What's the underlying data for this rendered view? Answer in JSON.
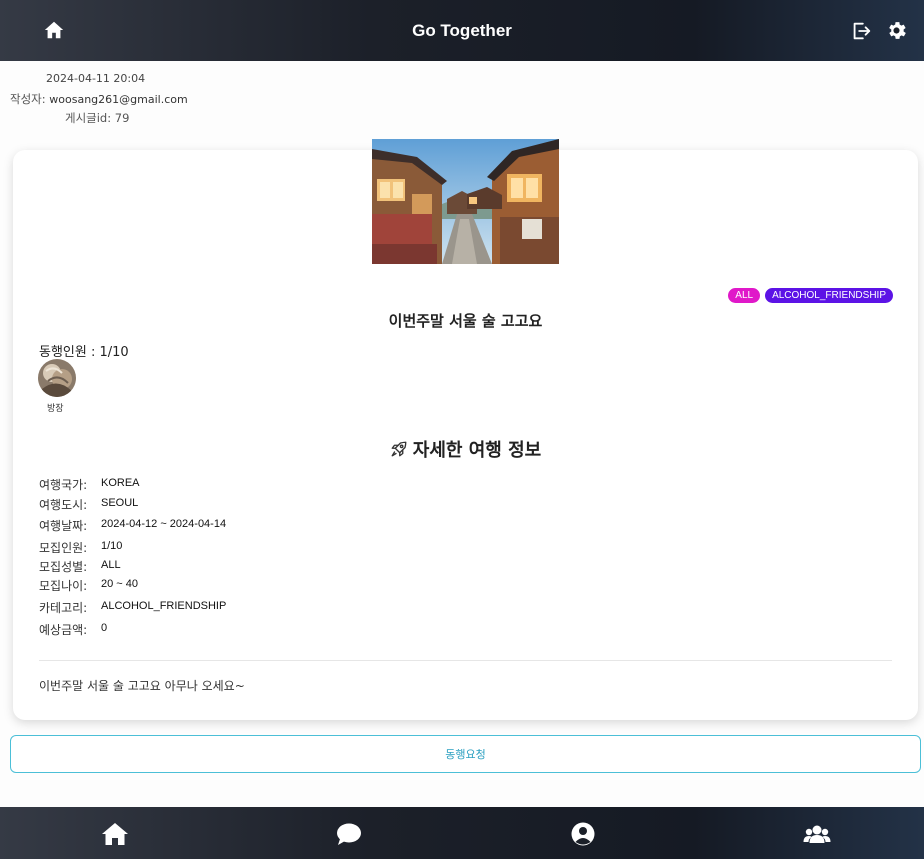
{
  "header": {
    "title": "Go Together"
  },
  "post_meta": {
    "date": "2024-04-11 20:04",
    "author_label": "작성자:",
    "author_value": "woosang261@gmail.com",
    "post_id_label": "게시글id:",
    "post_id_value": "79"
  },
  "post": {
    "tags": [
      "ALL",
      "ALCOHOL_FRIENDSHIP"
    ],
    "title": "이번주말 서울 술 고고요",
    "members_label": "동행인원 : 1/10",
    "leader_label": "방장",
    "details_title": "자세한 여행 정보",
    "details": [
      {
        "label": "여행국가:",
        "value": "KOREA"
      },
      {
        "label": "여행도시:",
        "value": "SEOUL"
      },
      {
        "label": "여행날짜:",
        "value": "2024-04-12 ~ 2024-04-14"
      },
      {
        "label": "모집인원:",
        "value": "1/10"
      },
      {
        "label": "모집성별:",
        "value": "ALL"
      },
      {
        "label": "모집나이:",
        "value": "20 ~ 40"
      },
      {
        "label": "카테고리:",
        "value": "ALCOHOL_FRIENDSHIP"
      },
      {
        "label": "예상금액:",
        "value": "0"
      }
    ],
    "content": "이번주말 서울 술 고고요 아무나 오세요~"
  },
  "actions": {
    "request_label": "동행요청"
  },
  "bottom_nav": {
    "items": [
      "home-icon",
      "chat-icon",
      "user-circle-icon",
      "users-icon"
    ]
  },
  "colors": {
    "tag_all": "#e018c9",
    "tag_category": "#5c13e6",
    "request_border": "#4bbfd7"
  }
}
